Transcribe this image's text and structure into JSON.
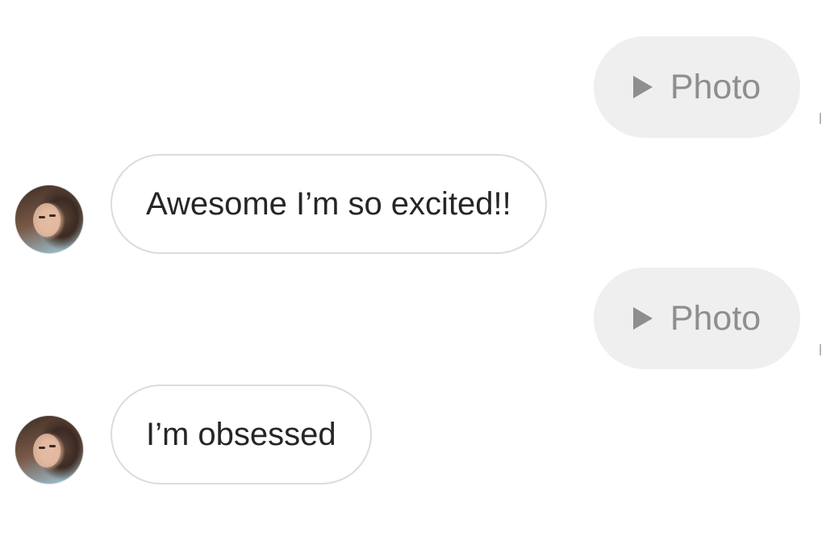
{
  "messages": [
    {
      "type": "sent",
      "icon": "play-icon",
      "label": "Photo"
    },
    {
      "type": "received",
      "text": "Awesome I’m so excited!!"
    },
    {
      "type": "sent",
      "icon": "play-icon",
      "label": "Photo"
    },
    {
      "type": "received",
      "text": "I’m obsessed"
    }
  ],
  "colors": {
    "sent_bubble": "#efefef",
    "sent_text": "#8e8e8e",
    "received_border": "#dcdcdc",
    "received_text": "#262626"
  }
}
